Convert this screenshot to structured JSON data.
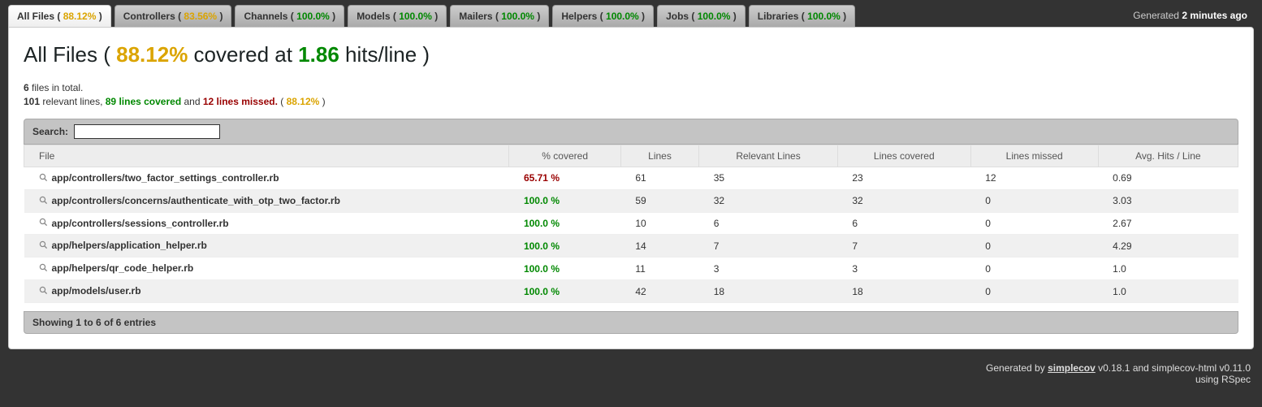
{
  "tabs": [
    {
      "label": "All Files",
      "pct": "88.12%",
      "cls": "yellow"
    },
    {
      "label": "Controllers",
      "pct": "83.56%",
      "cls": "yellow"
    },
    {
      "label": "Channels",
      "pct": "100.0%",
      "cls": "green"
    },
    {
      "label": "Models",
      "pct": "100.0%",
      "cls": "green"
    },
    {
      "label": "Mailers",
      "pct": "100.0%",
      "cls": "green"
    },
    {
      "label": "Helpers",
      "pct": "100.0%",
      "cls": "green"
    },
    {
      "label": "Jobs",
      "pct": "100.0%",
      "cls": "green"
    },
    {
      "label": "Libraries",
      "pct": "100.0%",
      "cls": "green"
    }
  ],
  "generated": {
    "prefix": "Generated ",
    "time": "2 minutes ago"
  },
  "heading": {
    "prefix": "All Files ( ",
    "covered_pct": "88.12%",
    "mid": " covered at ",
    "hits": "1.86",
    "suffix": " hits/line )"
  },
  "summary1": {
    "count": "6",
    "text": " files in total."
  },
  "summary2": {
    "relevant": "101",
    "relevant_text": " relevant lines, ",
    "covered": "89",
    "covered_text": " lines covered",
    "and": " and ",
    "missed": "12",
    "missed_text": " lines missed.",
    "pct_open": " ( ",
    "pct": "88.12%",
    "pct_close": " )"
  },
  "search_label": "Search:",
  "columns": [
    "File",
    "% covered",
    "Lines",
    "Relevant Lines",
    "Lines covered",
    "Lines missed",
    "Avg. Hits / Line"
  ],
  "rows": [
    {
      "file": "app/controllers/two_factor_settings_controller.rb",
      "covered": "65.71 %",
      "covered_cls": "red",
      "lines": "61",
      "relevant": "35",
      "lines_covered": "23",
      "missed": "12",
      "avg": "0.69"
    },
    {
      "file": "app/controllers/concerns/authenticate_with_otp_two_factor.rb",
      "covered": "100.0 %",
      "covered_cls": "green",
      "lines": "59",
      "relevant": "32",
      "lines_covered": "32",
      "missed": "0",
      "avg": "3.03"
    },
    {
      "file": "app/controllers/sessions_controller.rb",
      "covered": "100.0 %",
      "covered_cls": "green",
      "lines": "10",
      "relevant": "6",
      "lines_covered": "6",
      "missed": "0",
      "avg": "2.67"
    },
    {
      "file": "app/helpers/application_helper.rb",
      "covered": "100.0 %",
      "covered_cls": "green",
      "lines": "14",
      "relevant": "7",
      "lines_covered": "7",
      "missed": "0",
      "avg": "4.29"
    },
    {
      "file": "app/helpers/qr_code_helper.rb",
      "covered": "100.0 %",
      "covered_cls": "green",
      "lines": "11",
      "relevant": "3",
      "lines_covered": "3",
      "missed": "0",
      "avg": "1.0"
    },
    {
      "file": "app/models/user.rb",
      "covered": "100.0 %",
      "covered_cls": "green",
      "lines": "42",
      "relevant": "18",
      "lines_covered": "18",
      "missed": "0",
      "avg": "1.0"
    }
  ],
  "footer_info": "Showing 1 to 6 of 6 entries",
  "page_footer": {
    "prefix": "Generated by ",
    "link": "simplecov",
    "rest": " v0.18.1 and simplecov-html v0.11.0",
    "line2": "using RSpec"
  }
}
